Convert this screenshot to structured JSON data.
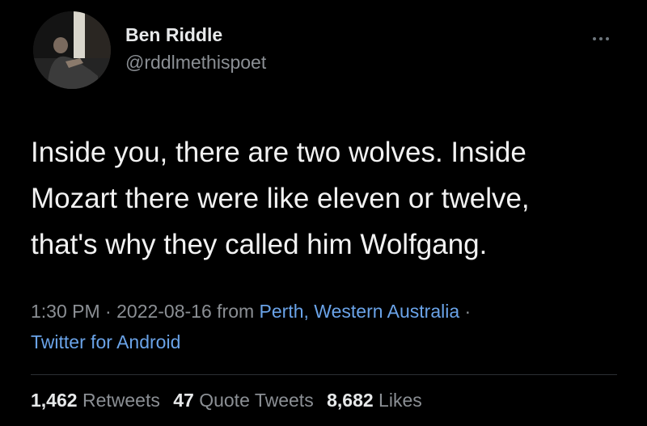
{
  "author": {
    "name": "Ben Riddle",
    "handle": "@rddlmethispoet",
    "avatar_icon": "profile-photo"
  },
  "tweet": {
    "text": "Inside you, there are two wolves. Inside\nMozart there were like eleven or twelve,\nthat's why they called him Wolfgang."
  },
  "meta": {
    "time": "1:30 PM",
    "sep1": " · ",
    "date": "2022-08-16",
    "from_label": " from ",
    "location": "Perth, Western Australia",
    "sep2": " ·",
    "source": "Twitter for Android"
  },
  "stats": {
    "retweets_count": "1,462",
    "retweets_label": "Retweets",
    "quotes_count": "47",
    "quotes_label": "Quote Tweets",
    "likes_count": "8,682",
    "likes_label": "Likes"
  },
  "colors": {
    "background": "#000000",
    "link": "#6aa3e8",
    "secondary_text": "#8b8f94"
  },
  "icons": {
    "more": "more-options-icon"
  }
}
